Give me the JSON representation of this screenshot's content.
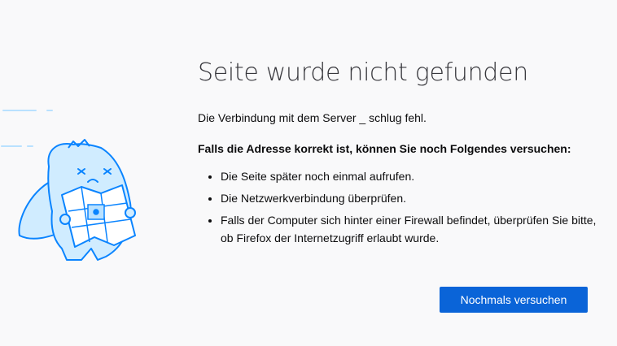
{
  "error": {
    "title": "Seite wurde nicht gefunden",
    "description": "Die Verbindung mit dem Server _ schlug fehl.",
    "suggestion_heading": "Falls die Adresse korrekt ist, können Sie noch Folgendes versuchen:",
    "suggestions": [
      "Die Seite später noch einmal aufrufen.",
      "Die Netzwerkverbindung überprüfen.",
      "Falls der Computer sich hinter einer Firewall befindet, überprüfen Sie bitte, ob Firefox der Internetzugriff erlaubt wurde."
    ],
    "retry_label": "Nochmals versuchen"
  },
  "illustration": {
    "icon": "lost-dino-with-map-icon",
    "stroke_color": "#0a84ff",
    "fill_color": "#d0ecff"
  },
  "colors": {
    "background": "#f9f9fa",
    "primary_button": "#0a64d8"
  }
}
